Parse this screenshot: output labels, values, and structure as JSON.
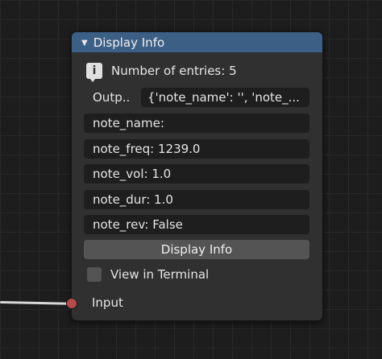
{
  "node": {
    "title": "Display Info",
    "entries_text": "Number of entries: 5",
    "output_label": "Outp..",
    "output_value": "{'note_name': '', 'note_...",
    "fields": [
      "note_name:",
      "note_freq: 1239.0",
      "note_vol: 1.0",
      "note_dur: 1.0",
      "note_rev: False"
    ],
    "button_label": "Display Info",
    "checkbox_label": "View in Terminal",
    "checkbox_checked": false,
    "input_label": "Input"
  },
  "colors": {
    "header": "#3c5f85",
    "socket": "#b84a4a",
    "background": "#1d1d1d"
  },
  "icons": {
    "collapse": "triangle-down-icon",
    "info": "info-speech-icon"
  }
}
